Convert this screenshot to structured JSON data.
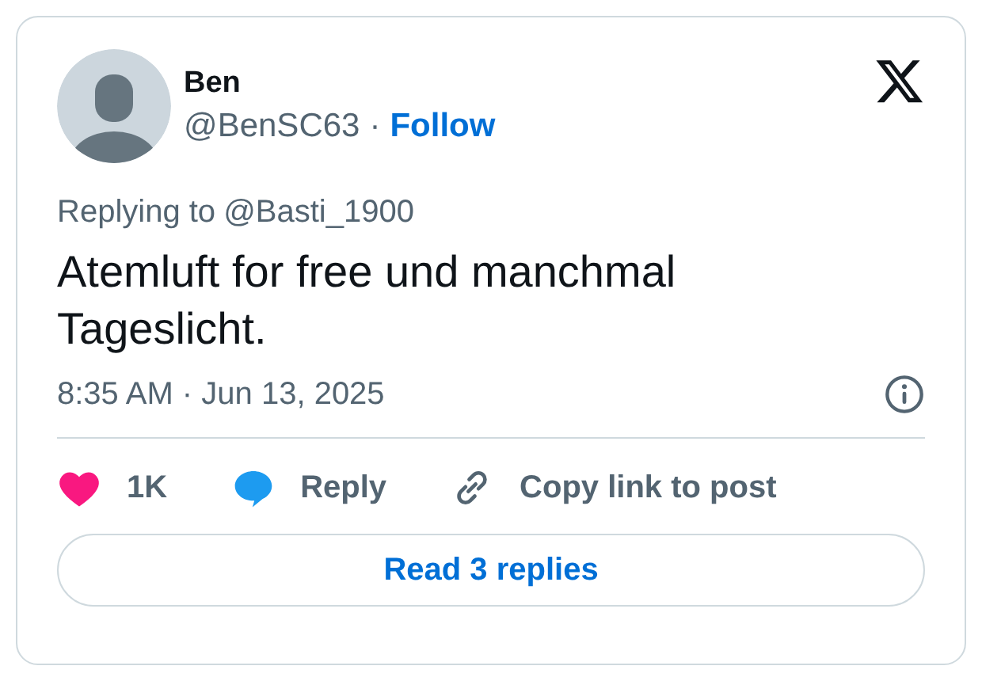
{
  "author": {
    "name": "Ben",
    "handle": "@BenSC63",
    "separator": "·",
    "follow": "Follow"
  },
  "replying_to": {
    "label": "Replying to",
    "handle": "@Basti_1900"
  },
  "text": "Atemluft for free und manchmal Tageslicht.",
  "timestamp": "8:35 AM · Jun 13, 2025",
  "actions": [
    {
      "kind": "like",
      "label": "1K",
      "liked": true
    },
    {
      "kind": "reply",
      "label": "Reply"
    },
    {
      "kind": "copy",
      "label": "Copy link to post"
    }
  ],
  "read_replies": "Read 3 replies"
}
